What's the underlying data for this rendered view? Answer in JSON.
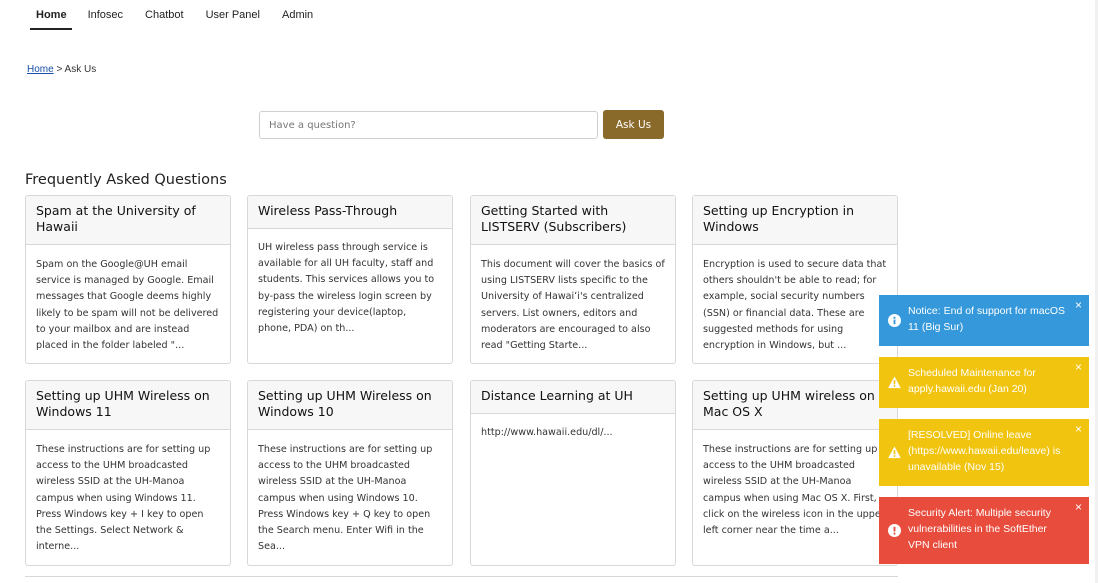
{
  "nav": {
    "tabs": [
      "Home",
      "Infosec",
      "Chatbot",
      "User Panel",
      "Admin"
    ],
    "active": "Home"
  },
  "breadcrumb": {
    "home": "Home",
    "separator": ">",
    "current": "Ask Us"
  },
  "search": {
    "placeholder": "Have a question?",
    "value": "",
    "button_label": "Ask Us"
  },
  "faq": {
    "heading": "Frequently Asked Questions",
    "cards": [
      {
        "title": "Spam at the University of Hawaii",
        "excerpt": "Spam on the Google@UH email service is managed by Google. Email messages that Google deems highly likely to be spam will not be delivered to your mailbox and are instead placed in the folder labeled \"..."
      },
      {
        "title": "Wireless Pass-Through",
        "excerpt": "UH wireless pass through service is available for all UH faculty, staff and students. This services allows you to by-pass the wireless login screen by registering your device(laptop, phone, PDA) on th..."
      },
      {
        "title": "Getting Started with LISTSERV (Subscribers)",
        "excerpt": "This document will cover the basics of using LISTSERV lists specific to the University of Hawaiʻi's centralized servers. List owners, editors and moderators are encouraged to also read \"Getting Starte..."
      },
      {
        "title": "Setting up Encryption in Windows",
        "excerpt": "Encryption is used to secure data that others shouldn't be able to read; for example, social security numbers (SSN) or financial data. These are suggested methods for using encryption in Windows, but ..."
      },
      {
        "title": "Setting up UHM Wireless on Windows 11",
        "excerpt": "These instructions are for setting up access to the UHM broadcasted wireless SSID at the UH-Manoa campus when using Windows 11. Press Windows key + I key to open the Settings. Select Network & interne..."
      },
      {
        "title": "Setting up UHM Wireless on Windows 10",
        "excerpt": "These instructions are for setting up access to the UHM broadcasted wireless SSID at the UH-Manoa campus when using Windows 10. Press Windows key + Q key to open the Search menu. Enter Wifi in the Sea..."
      },
      {
        "title": "Distance Learning at UH",
        "excerpt": "http://www.hawaii.edu/dl/..."
      },
      {
        "title": "Setting up UHM wireless on Mac OS X",
        "excerpt": "These instructions are for setting up access to the UHM broadcasted wireless SSID at the UH-Manoa campus when using Mac OS X. First, click on the wireless icon in the upper left corner near the time a..."
      }
    ]
  },
  "notifications": [
    {
      "type": "info",
      "icon": "info-icon",
      "color": "#3498db",
      "text": "Notice: End of support for macOS 11 (Big Sur)"
    },
    {
      "type": "warning",
      "icon": "warning-icon",
      "color": "#f1c40f",
      "text": "Scheduled Maintenance for apply.hawaii.edu (Jan 20)"
    },
    {
      "type": "warning",
      "icon": "warning-icon",
      "color": "#f1c40f",
      "text": "[RESOLVED] Online leave (https://www.hawaii.edu/leave) is unavailable (Nov 15)"
    },
    {
      "type": "danger",
      "icon": "alert-icon",
      "color": "#e74c3c",
      "text": "Security Alert: Multiple security vulnerabilities in the SoftEther VPN client"
    }
  ],
  "close_glyph": "×",
  "colors": {
    "ask_button": "#8a6a2b",
    "link": "#1a4fa3"
  }
}
